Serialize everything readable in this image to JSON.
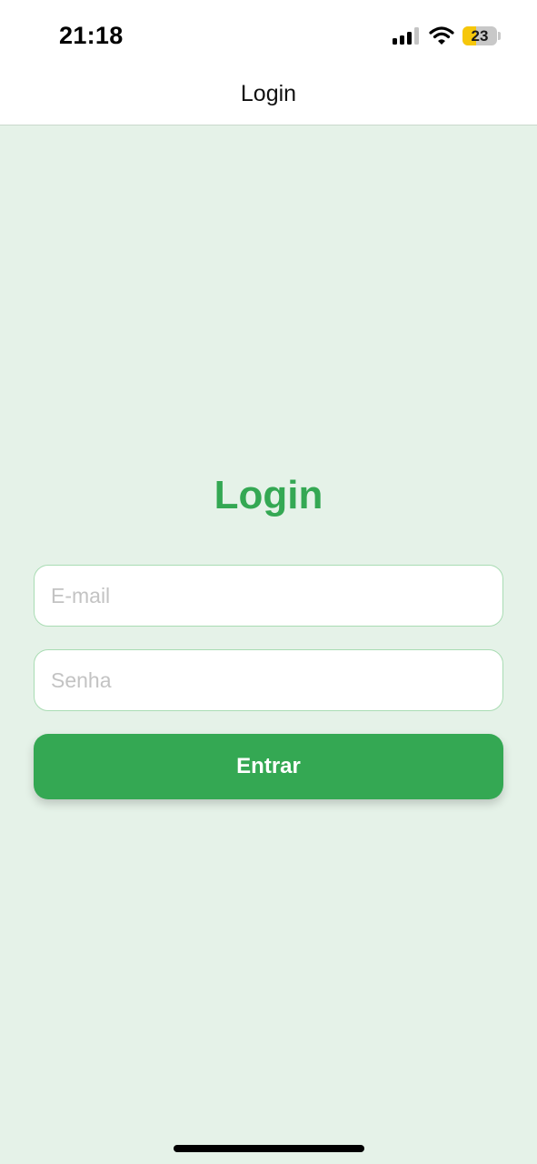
{
  "status_bar": {
    "time": "21:18",
    "battery_level": "23",
    "battery_fraction": 0.23,
    "icons": [
      "cellular-signal-icon",
      "wifi-icon",
      "battery-icon"
    ],
    "battery_color": "#f6c70a"
  },
  "nav": {
    "title": "Login"
  },
  "form": {
    "heading": "Login",
    "email": {
      "value": "",
      "placeholder": "E-mail"
    },
    "password": {
      "value": "",
      "placeholder": "Senha"
    },
    "submit_label": "Entrar"
  },
  "colors": {
    "accent": "#34a853",
    "background": "#e5f2e8",
    "input_border": "#a9dcb3",
    "placeholder": "#c3c3c3"
  }
}
